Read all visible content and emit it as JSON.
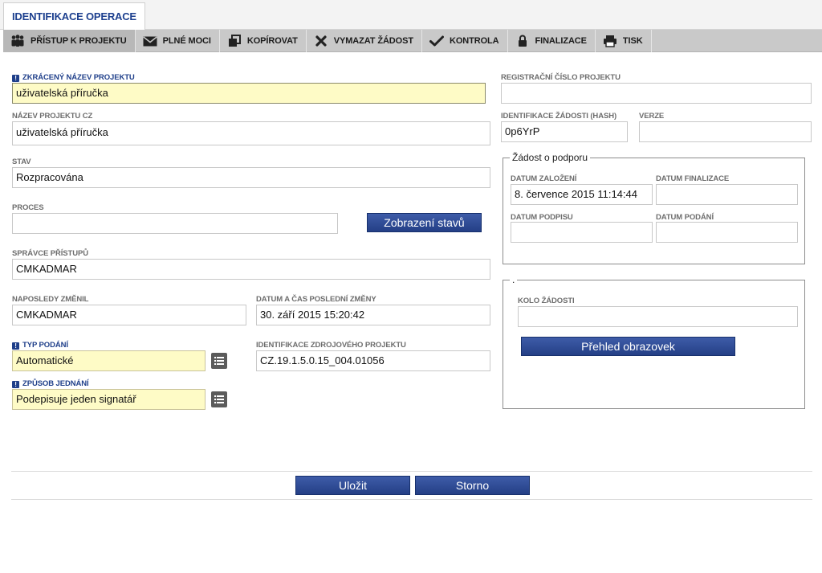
{
  "tab": {
    "label": "IDENTIFIKACE OPERACE"
  },
  "toolbar": {
    "items": [
      {
        "label": "PŘÍSTUP K PROJEKTU",
        "icon": "people-icon"
      },
      {
        "label": "PLNÉ MOCI",
        "icon": "envelope-icon"
      },
      {
        "label": "KOPÍROVAT",
        "icon": "copy-icon"
      },
      {
        "label": "VYMAZAT ŽÁDOST",
        "icon": "delete-x-icon"
      },
      {
        "label": "KONTROLA",
        "icon": "checkmark-icon"
      },
      {
        "label": "FINALIZACE",
        "icon": "lock-icon"
      },
      {
        "label": "TISK",
        "icon": "printer-icon"
      }
    ]
  },
  "form": {
    "short_name": {
      "label": "ZKRÁCENÝ NÁZEV PROJEKTU",
      "value": "uživatelská příručka"
    },
    "name_cz": {
      "label": "NÁZEV PROJEKTU CZ",
      "value": "uživatelská příručka"
    },
    "status": {
      "label": "STAV",
      "value": "Rozpracována"
    },
    "process": {
      "label": "PROCES",
      "value": ""
    },
    "show_states_button": "Zobrazení stavů",
    "access_admin": {
      "label": "SPRÁVCE PŘÍSTUPŮ",
      "value": "CMKADMAR"
    },
    "last_changed_by": {
      "label": "NAPOSLEDY ZMĚNIL",
      "value": "CMKADMAR"
    },
    "last_change_datetime": {
      "label": "DATUM A ČAS POSLEDNÍ ZMĚNY",
      "value": "30. září 2015 15:20:42"
    },
    "submission_type": {
      "label": "TYP PODÁNÍ",
      "value": "Automatické"
    },
    "source_project_id": {
      "label": "IDENTIFIKACE ZDROJOVÉHO PROJEKTU",
      "value": "CZ.19.1.5.0.15_004.01056"
    },
    "proceeding_method": {
      "label": "ZPŮSOB JEDNÁNÍ",
      "value": "Podepisuje jeden signatář"
    },
    "registration_number": {
      "label": "REGISTRAČNÍ ČÍSLO PROJEKTU",
      "value": ""
    },
    "request_hash": {
      "label": "IDENTIFIKACE ŽÁDOSTI (HASH)",
      "value": "0p6YrP"
    },
    "version": {
      "label": "VERZE",
      "value": ""
    }
  },
  "support_group": {
    "legend": "Žádost o podporu",
    "created": {
      "label": "DATUM ZALOŽENÍ",
      "value": "8. července 2015 11:14:44"
    },
    "finalized": {
      "label": "DATUM FINALIZACE",
      "value": ""
    },
    "signed": {
      "label": "DATUM PODPISU",
      "value": ""
    },
    "submitted": {
      "label": "DATUM PODÁNÍ",
      "value": ""
    }
  },
  "round_group": {
    "legend": ".",
    "round": {
      "label": "KOLO ŽÁDOSTI",
      "value": ""
    },
    "overview_button": "Přehled obrazovek"
  },
  "footer": {
    "save_label": "Uložit",
    "cancel_label": "Storno"
  }
}
